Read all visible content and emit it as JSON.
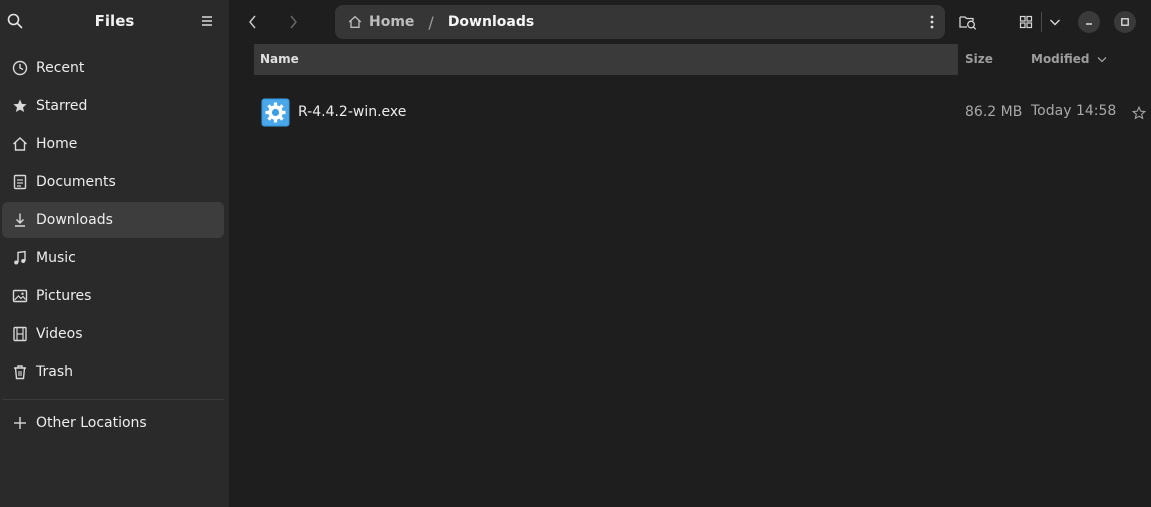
{
  "sidebar": {
    "title": "Files",
    "items": [
      {
        "label": "Recent",
        "icon": "clock-icon"
      },
      {
        "label": "Starred",
        "icon": "star-icon"
      },
      {
        "label": "Home",
        "icon": "home-icon"
      },
      {
        "label": "Documents",
        "icon": "document-icon"
      },
      {
        "label": "Downloads",
        "icon": "download-icon",
        "active": true
      },
      {
        "label": "Music",
        "icon": "music-note-icon"
      },
      {
        "label": "Pictures",
        "icon": "picture-icon"
      },
      {
        "label": "Videos",
        "icon": "film-icon"
      },
      {
        "label": "Trash",
        "icon": "trash-icon"
      }
    ],
    "other_locations": "Other Locations"
  },
  "pathbar": {
    "home": "Home",
    "separator": "/",
    "current": "Downloads"
  },
  "columns": {
    "name": "Name",
    "size": "Size",
    "modified": "Modified"
  },
  "files": [
    {
      "name": "R-4.4.2-win.exe",
      "size": "86.2 MB",
      "modified": "Today 14:58",
      "icon": "executable-gear-icon"
    }
  ],
  "colors": {
    "window_bg": "#1e1e1e",
    "sidebar_bg": "#2a2a2a",
    "active_item": "#3d3d3d",
    "file_icon_blue": "#3b9fe6"
  }
}
